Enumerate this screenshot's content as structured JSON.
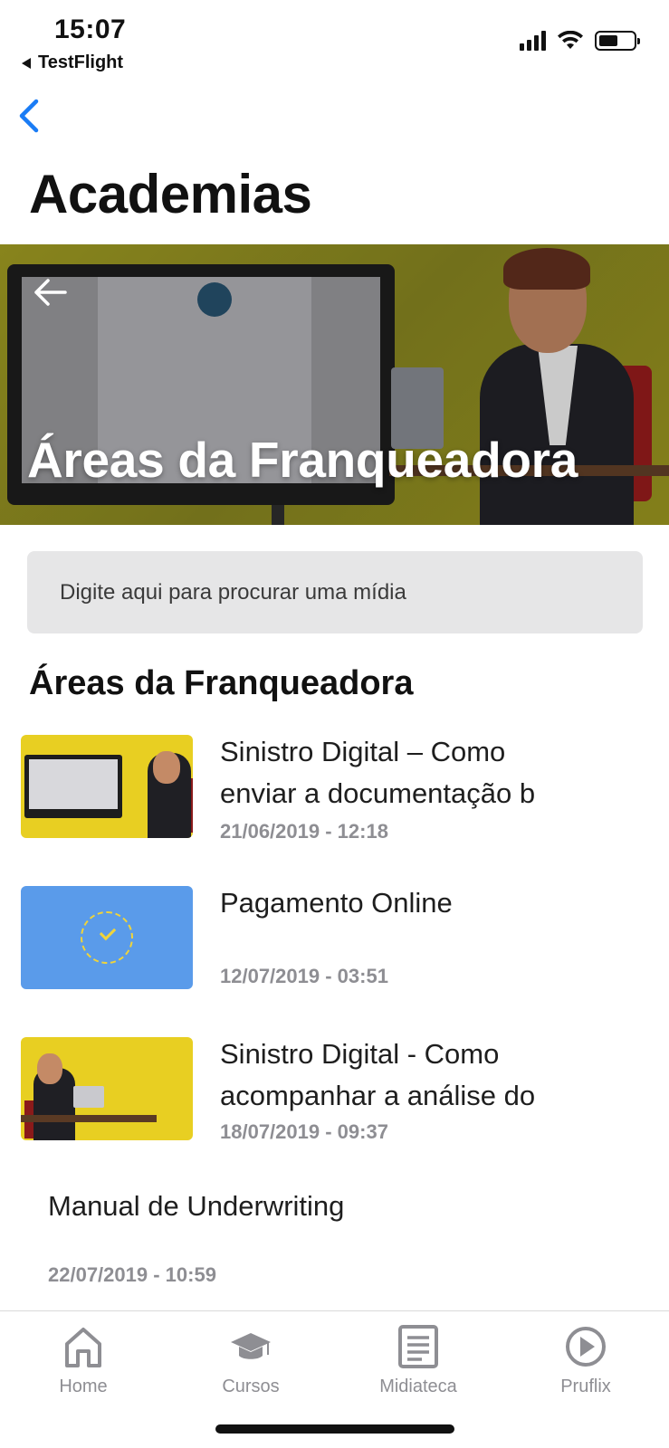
{
  "status_bar": {
    "time": "15:07",
    "back_app": "TestFlight",
    "icons": [
      "signal-icon",
      "wifi-icon",
      "battery-icon"
    ]
  },
  "nav": {
    "back_icon": "chevron-left-icon",
    "title": "Academias",
    "accent_color": "#1a7cf5"
  },
  "hero": {
    "back_icon": "arrow-left-icon",
    "title": "Áreas da Franqueadora"
  },
  "search": {
    "placeholder": "Digite aqui para procurar uma mídia"
  },
  "section": {
    "title": "Áreas da Franqueadora"
  },
  "media_items": [
    {
      "title": "Sinistro Digital – Como enviar a documentação b",
      "date": "21/06/2019 - 12:18",
      "thumbnail": "yellow-illustration"
    },
    {
      "title": "Pagamento Online",
      "date": "12/07/2019 - 03:51",
      "thumbnail": "blue-novidade-prudigital"
    },
    {
      "title": "Sinistro Digital - Como acompanhar a análise do",
      "date": "18/07/2019 - 09:37",
      "thumbnail": "yellow-illustration"
    },
    {
      "title": "Manual de Underwriting",
      "date": "22/07/2019 - 10:59",
      "thumbnail": ""
    }
  ],
  "tabbar": {
    "tabs": [
      {
        "label": "Home",
        "icon": "home-icon"
      },
      {
        "label": "Cursos",
        "icon": "graduation-cap-icon"
      },
      {
        "label": "Midiateca",
        "icon": "document-icon"
      },
      {
        "label": "Pruflix",
        "icon": "play-circle-icon"
      }
    ],
    "inactive_color": "#8e8e93"
  }
}
